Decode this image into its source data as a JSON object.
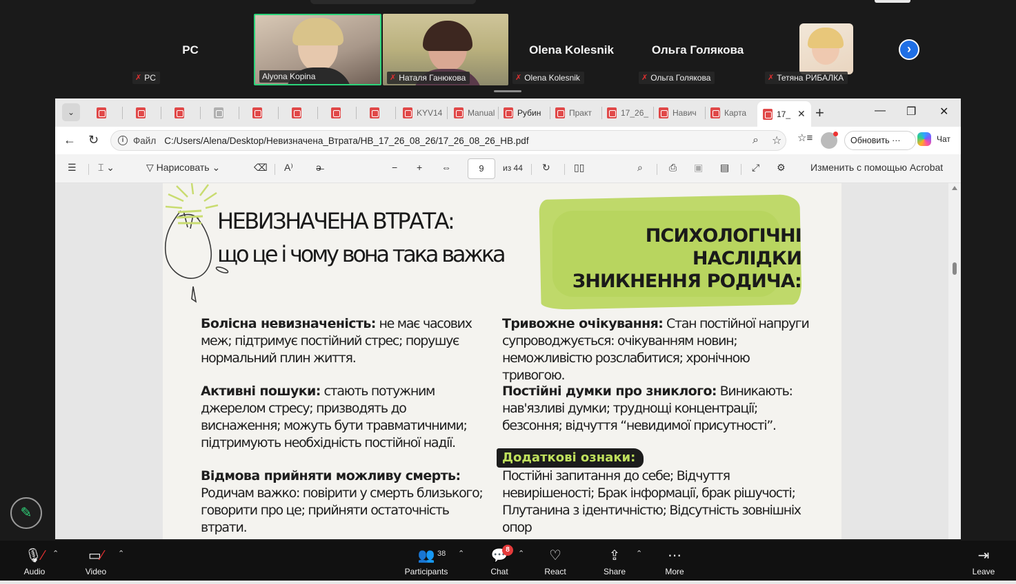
{
  "participants": [
    {
      "big_name": "PC",
      "tag": "PC",
      "muted": true
    },
    {
      "big_name": "",
      "tag": "Alyona Kopina",
      "muted": false,
      "active": true
    },
    {
      "big_name": "",
      "tag": "Наталя Ганюкова",
      "muted": true
    },
    {
      "big_name": "Olena Kolesnik",
      "tag": "Olena Kolesnik",
      "muted": true
    },
    {
      "big_name": "Ольга Голякова",
      "tag": "Ольга Голякова",
      "muted": true
    },
    {
      "big_name": "",
      "tag": "Тетяна РИБАЛКА",
      "muted": true
    }
  ],
  "browser": {
    "tabs": [
      "KYV14",
      "Manual",
      "Рубин",
      "Практ",
      "17_26_",
      "Навич",
      "Карта"
    ],
    "active_tab": "17_",
    "url_scheme": "Файл",
    "url": "C:/Users/Alena/Desktop/Невизначена_Втрата/НВ_17_26_08_26/17_26_08_26_НВ.pdf",
    "update_button": "Обновить",
    "chat_button": "Чат"
  },
  "pdf_toolbar": {
    "draw_label": "Нарисовать",
    "page_current": "9",
    "page_total": "из 44",
    "acrobat_label": "Изменить с помощью Acrobat"
  },
  "page": {
    "title_line1": "НЕВИЗНАЧЕНА ВТРАТА:",
    "title_line2": "що це і чому вона така важка",
    "right_heading_line1": "ПСИХОЛОГІЧНІ НАСЛІДКИ",
    "right_heading_line2": "ЗНИКНЕННЯ РОДИЧА:",
    "left_blocks": [
      {
        "bold": "Болісна невизначеність:",
        "text": " не має часових меж; підтримує постійний стрес; порушує нормальний плин життя."
      },
      {
        "bold": "Активні пошуки:",
        "text": " стають потужним джерелом стресу; призводять до виснаження; можуть бути травматичними; підтримують необхідність постійної надії."
      },
      {
        "bold": "Відмова прийняти можливу смерть:",
        "text": " Родичам важко: повірити у смерть близького; говорити про це; прийняти остаточність втрати."
      }
    ],
    "right_blocks": [
      {
        "bold": "Тривожне очікування:",
        "text": " Стан постійної напруги супроводжується: очікуванням новин; неможливістю розслабитися; хронічною тривогою."
      },
      {
        "bold": "Постійні думки про зниклого:",
        "text": " Виникають: нав'язливі думки; труднощі концентрації; безсоння; відчуття “невидимої присутності”."
      }
    ],
    "extra_label": "Додаткові ознаки:",
    "extra_text": "Постійні запитання до себе; Відчуття невирішеності; Брак інформації, брак рішучості; Плутанина з ідентичністю; Відсутність зовнішніх опор"
  },
  "controls": {
    "audio": "Audio",
    "video": "Video",
    "participants": "Participants",
    "participants_count": "38",
    "chat": "Chat",
    "chat_badge": "8",
    "react": "React",
    "share": "Share",
    "more": "More",
    "leave": "Leave"
  },
  "colors": {
    "accent_green": "#bfd96a",
    "active_border": "#2bd47a",
    "mute_red": "#e23030",
    "zoom_blue": "#1f6fe5"
  }
}
